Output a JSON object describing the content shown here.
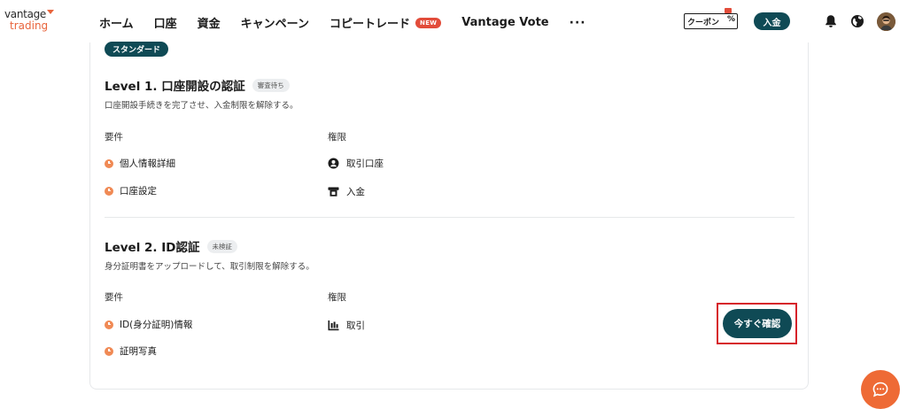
{
  "brand": {
    "line1": "vantage",
    "line2": "trading"
  },
  "nav": {
    "items": [
      "ホーム",
      "口座",
      "資金",
      "キャンペーン",
      "コピートレード",
      "Vantage Vote"
    ],
    "new_badge": "NEW",
    "more": "···"
  },
  "header": {
    "coupon_label": "クーポン",
    "coupon_symbol": "%",
    "deposit_label": "入金",
    "icons": [
      "bell-icon",
      "globe-icon",
      "avatar"
    ]
  },
  "card": {
    "tag": "スタンダード",
    "level1": {
      "title": "Level 1. 口座開設の認証",
      "status": "審査待ち",
      "description": "口座開設手続きを完了させ、入金制限を解除する。",
      "requirements_label": "要件",
      "permissions_label": "権限",
      "requirements": [
        "個人情報詳細",
        "口座設定"
      ],
      "permissions": [
        "取引口座",
        "入金"
      ]
    },
    "level2": {
      "title": "Level 2. ID認証",
      "status": "未検証",
      "description": "身分証明書をアップロードして、取引制限を解除する。",
      "requirements_label": "要件",
      "permissions_label": "権限",
      "requirements": [
        "ID(身分証明)情報",
        "証明写真"
      ],
      "permissions": [
        "取引"
      ],
      "confirm_button": "今すぐ確認"
    }
  },
  "colors": {
    "primary": "#0f4a55",
    "accent": "#e8643c",
    "pending_dot": "#f08a55",
    "badge_new": "#e24c3a",
    "highlight": "#d6212a"
  }
}
